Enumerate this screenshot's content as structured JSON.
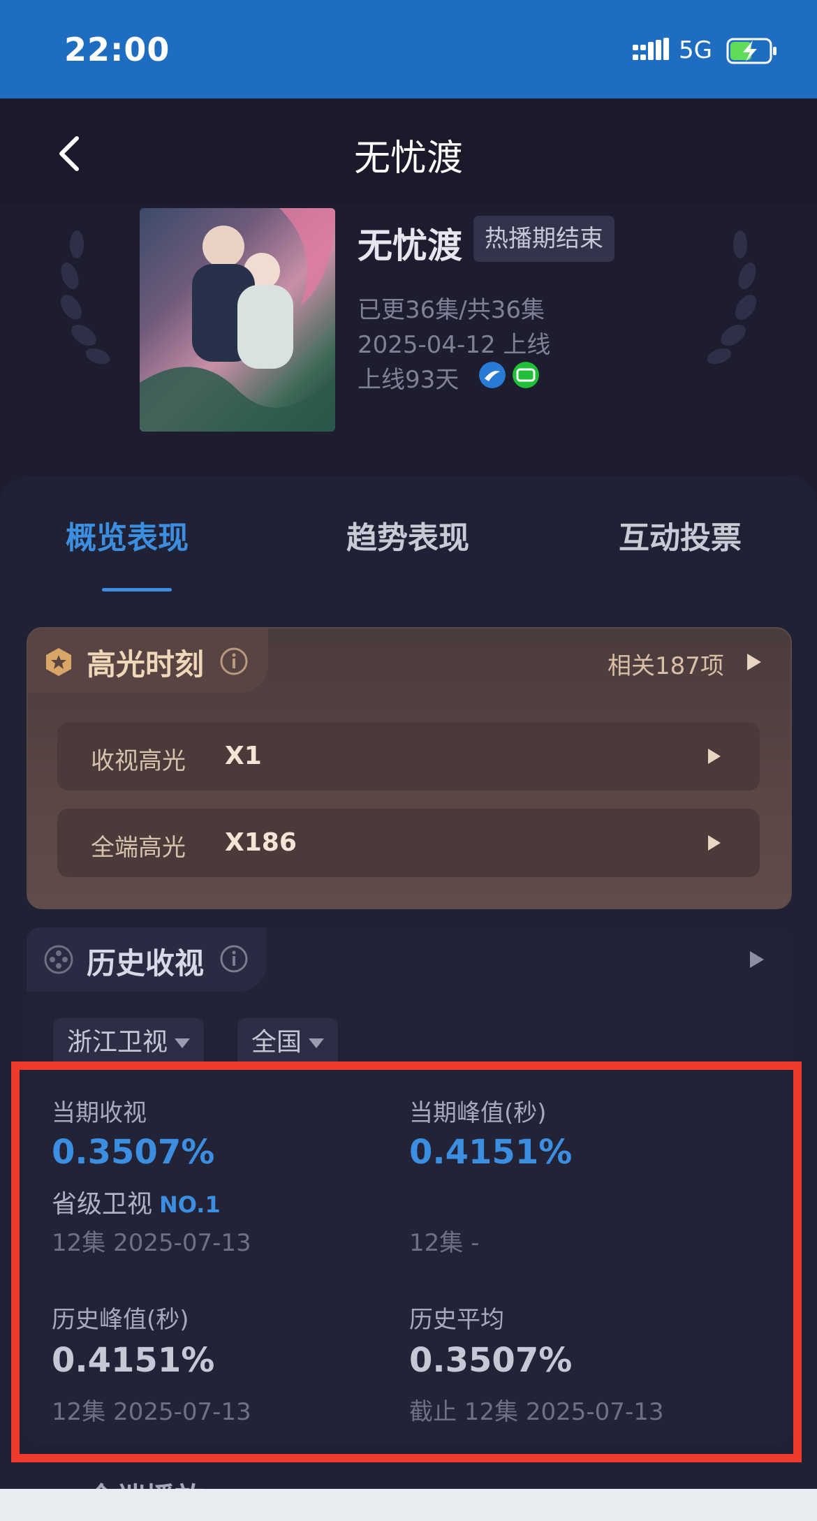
{
  "status_bar": {
    "time": "22:00",
    "network": "5G"
  },
  "header": {
    "title": "无忧渡"
  },
  "show": {
    "name": "无忧渡",
    "status": "热播期结束",
    "episodes": "已更36集/共36集",
    "release": "2025-04-12 上线",
    "days_online": "上线93天",
    "platforms": [
      "zhejiang-tv-icon",
      "iqiyi-icon"
    ]
  },
  "tabs": [
    "概览表现",
    "趋势表现",
    "互动投票"
  ],
  "highlights": {
    "title": "高光时刻",
    "count": "相关187项",
    "rows": [
      {
        "label": "收视高光",
        "value": "X1"
      },
      {
        "label": "全端高光",
        "value": "X186"
      }
    ]
  },
  "history": {
    "title": "历史收视",
    "filters": [
      "浙江卫视",
      "全国"
    ],
    "current": {
      "label": "当期收视",
      "value": "0.3507%",
      "rank_label": "省级卫视",
      "rank": "NO.1",
      "sub": "12集 2025-07-13"
    },
    "current_peak": {
      "label": "当期峰值(秒)",
      "value": "0.4151%",
      "sub": "12集 -"
    },
    "hist_peak": {
      "label": "历史峰值(秒)",
      "value": "0.4151%",
      "sub": "12集 2025-07-13"
    },
    "hist_avg": {
      "label": "历史平均",
      "value": "0.3507%",
      "sub": "截止 12集 2025-07-13"
    }
  },
  "next_section": {
    "title": "全端播放"
  },
  "colors": {
    "accent": "#3c8fe0",
    "highlight_box": "#ef3a2c",
    "status_bar": "#1f6dc0"
  }
}
